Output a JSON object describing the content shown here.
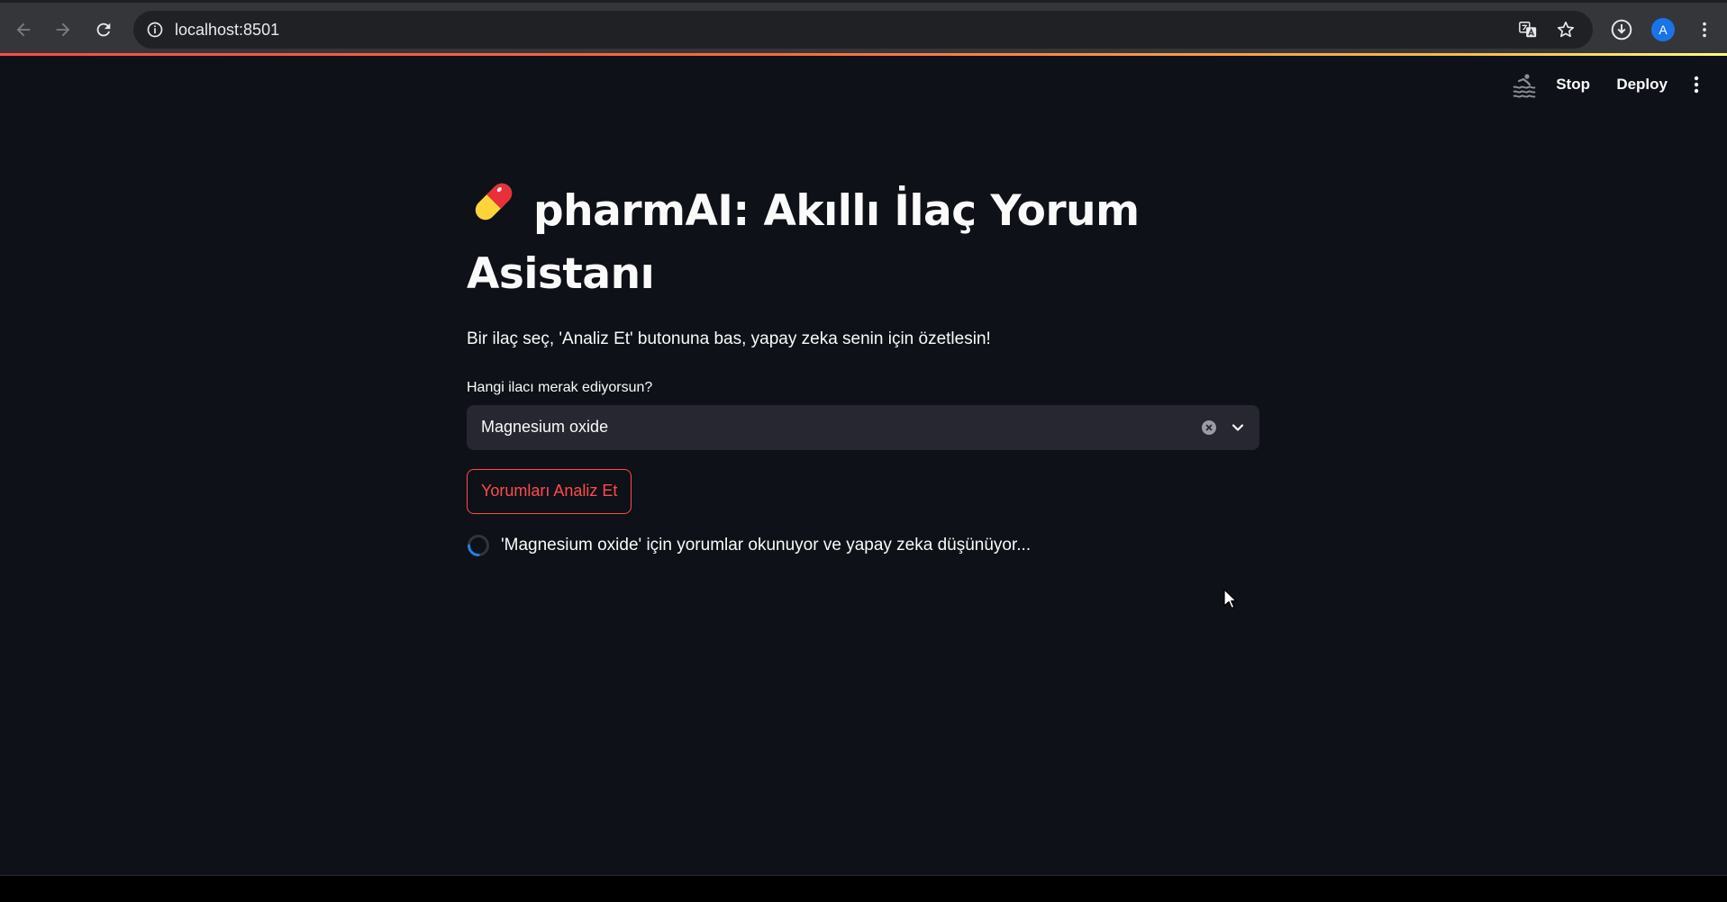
{
  "browser": {
    "url": "localhost:8501",
    "avatar_letter": "A",
    "icons": [
      "back-icon",
      "forward-icon",
      "reload-icon",
      "site-info-icon",
      "translate-icon",
      "bookmark-star-icon",
      "download-icon",
      "profile-avatar",
      "chrome-menu-icon"
    ]
  },
  "app_header": {
    "stop_label": "Stop",
    "deploy_label": "Deploy"
  },
  "main": {
    "title": "pharmAI: Akıllı İlaç Yorum Asistanı",
    "caption": "Bir ilaç seç, 'Analiz Et' butonuna bas, yapay zeka senin için özetlesin!",
    "select_label": "Hangi ilacı merak ediyorsun?",
    "select_value": "Magnesium oxide",
    "button_label": "Yorumları Analiz Et",
    "spinner_text": "'Magnesium oxide' için yorumlar okunuyor ve yapay zeka düşünüyor..."
  },
  "colors": {
    "app_bg": "#0e1117",
    "accent": "#ff4b4b",
    "input_bg": "#262730",
    "text": "#fafafa"
  }
}
